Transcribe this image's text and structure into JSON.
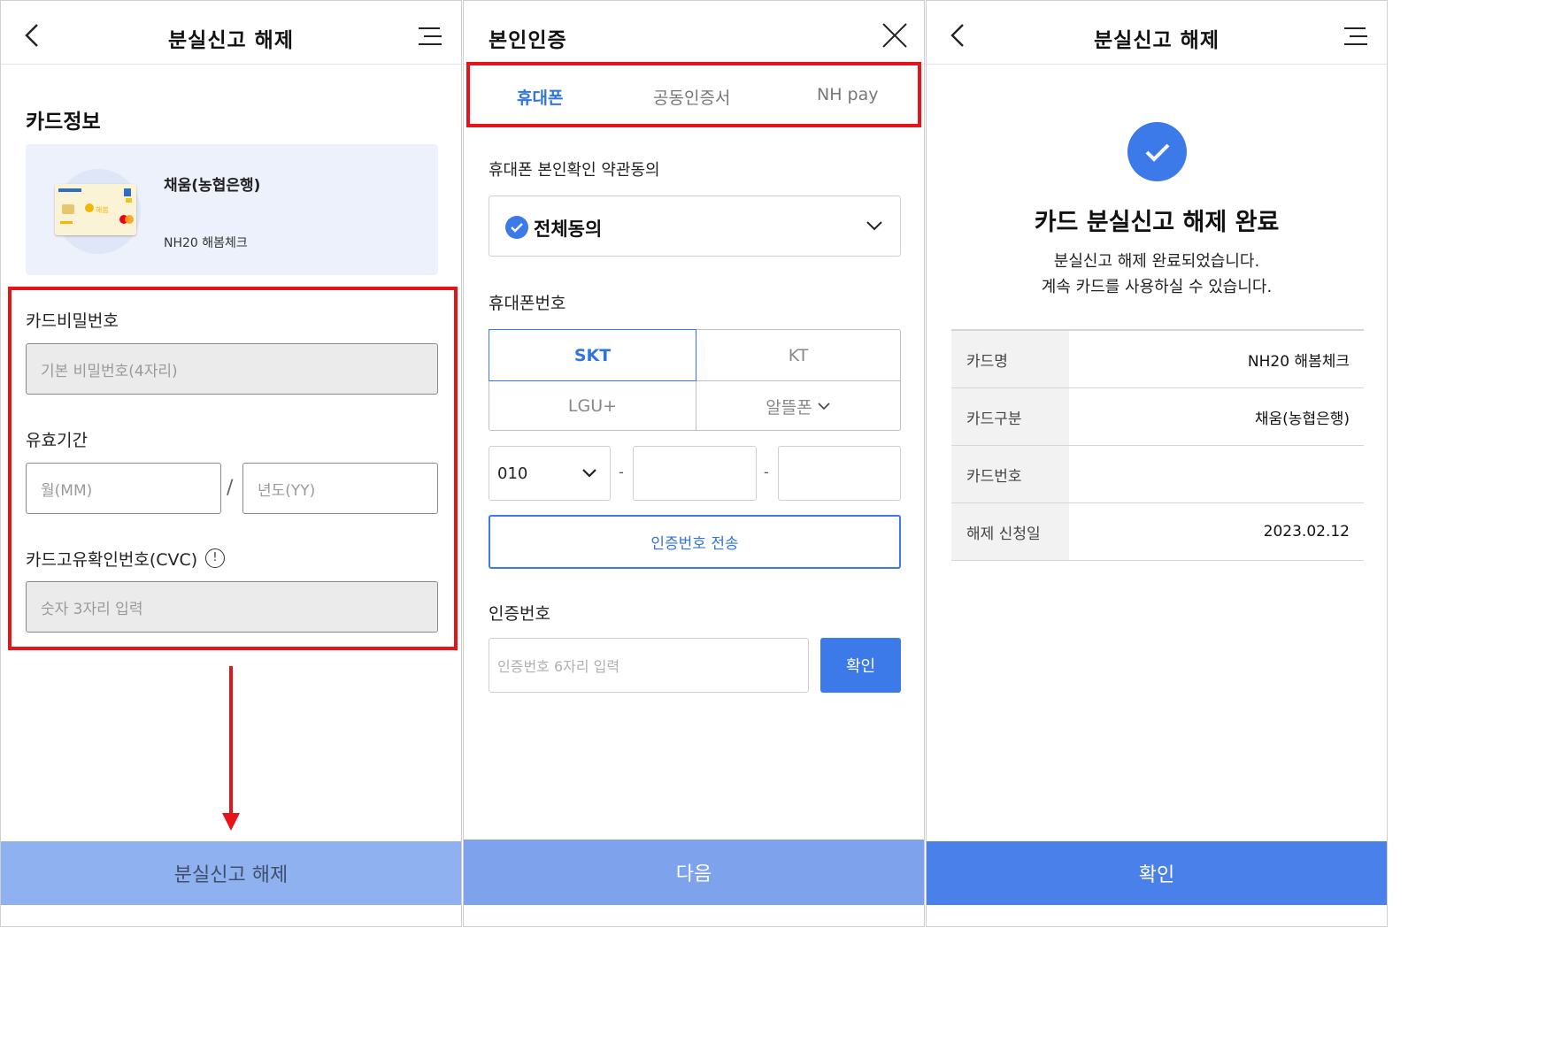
{
  "screen1": {
    "title": "분실신고 해제",
    "card_section_title": "카드정보",
    "card": {
      "name": "채움(농협은행)",
      "product": "NH20 해봄체크"
    },
    "pin_label": "카드비밀번호",
    "pin_placeholder": "기본 비밀번호(4자리)",
    "expiry_label": "유효기간",
    "month_placeholder": "월(MM)",
    "slash": "/",
    "year_placeholder": "년도(YY)",
    "cvc_label": "카드고유확인번호(CVC)",
    "cvc_info": "!",
    "cvc_placeholder": "숫자 3자리 입력",
    "submit_label": "분실신고 해제",
    "submit_color": "#8fb1ef"
  },
  "screen2": {
    "title": "본인인증",
    "tabs": [
      {
        "label": "휴대폰",
        "active": true
      },
      {
        "label": "공동인증서",
        "active": false
      },
      {
        "label": "NH pay",
        "active": false
      }
    ],
    "terms_label": "휴대폰 본인확인 약관동의",
    "agree_all": "전체동의",
    "phone_label": "휴대폰번호",
    "carriers": [
      "SKT",
      "KT",
      "LGU+",
      "알뜰폰"
    ],
    "active_carrier": "SKT",
    "phone_prefix": "010",
    "dash": "-",
    "send_code_label": "인증번호 전송",
    "code_label": "인증번호",
    "code_placeholder": "인증번호 6자리 입력",
    "confirm_label": "확인",
    "next_label": "다음",
    "next_color": "#7ea2ec"
  },
  "screen3": {
    "title": "분실신고 해제",
    "done_title": "카드 분실신고 해제 완료",
    "done_line1": "분실신고 해제 완료되었습니다.",
    "done_line2": "계속 카드를 사용하실 수 있습니다.",
    "rows": [
      {
        "key": "카드명",
        "value": "NH20 해봄체크"
      },
      {
        "key": "카드구분",
        "value": "채움(농협은행)"
      },
      {
        "key": "카드번호",
        "value": ""
      },
      {
        "key": "해제 신청일",
        "value": "2023.02.12"
      }
    ],
    "confirm_label": "확인",
    "confirm_color": "#4a80ea"
  },
  "colors": {
    "accent": "#3b7ae8",
    "highlight": "#e41418"
  }
}
